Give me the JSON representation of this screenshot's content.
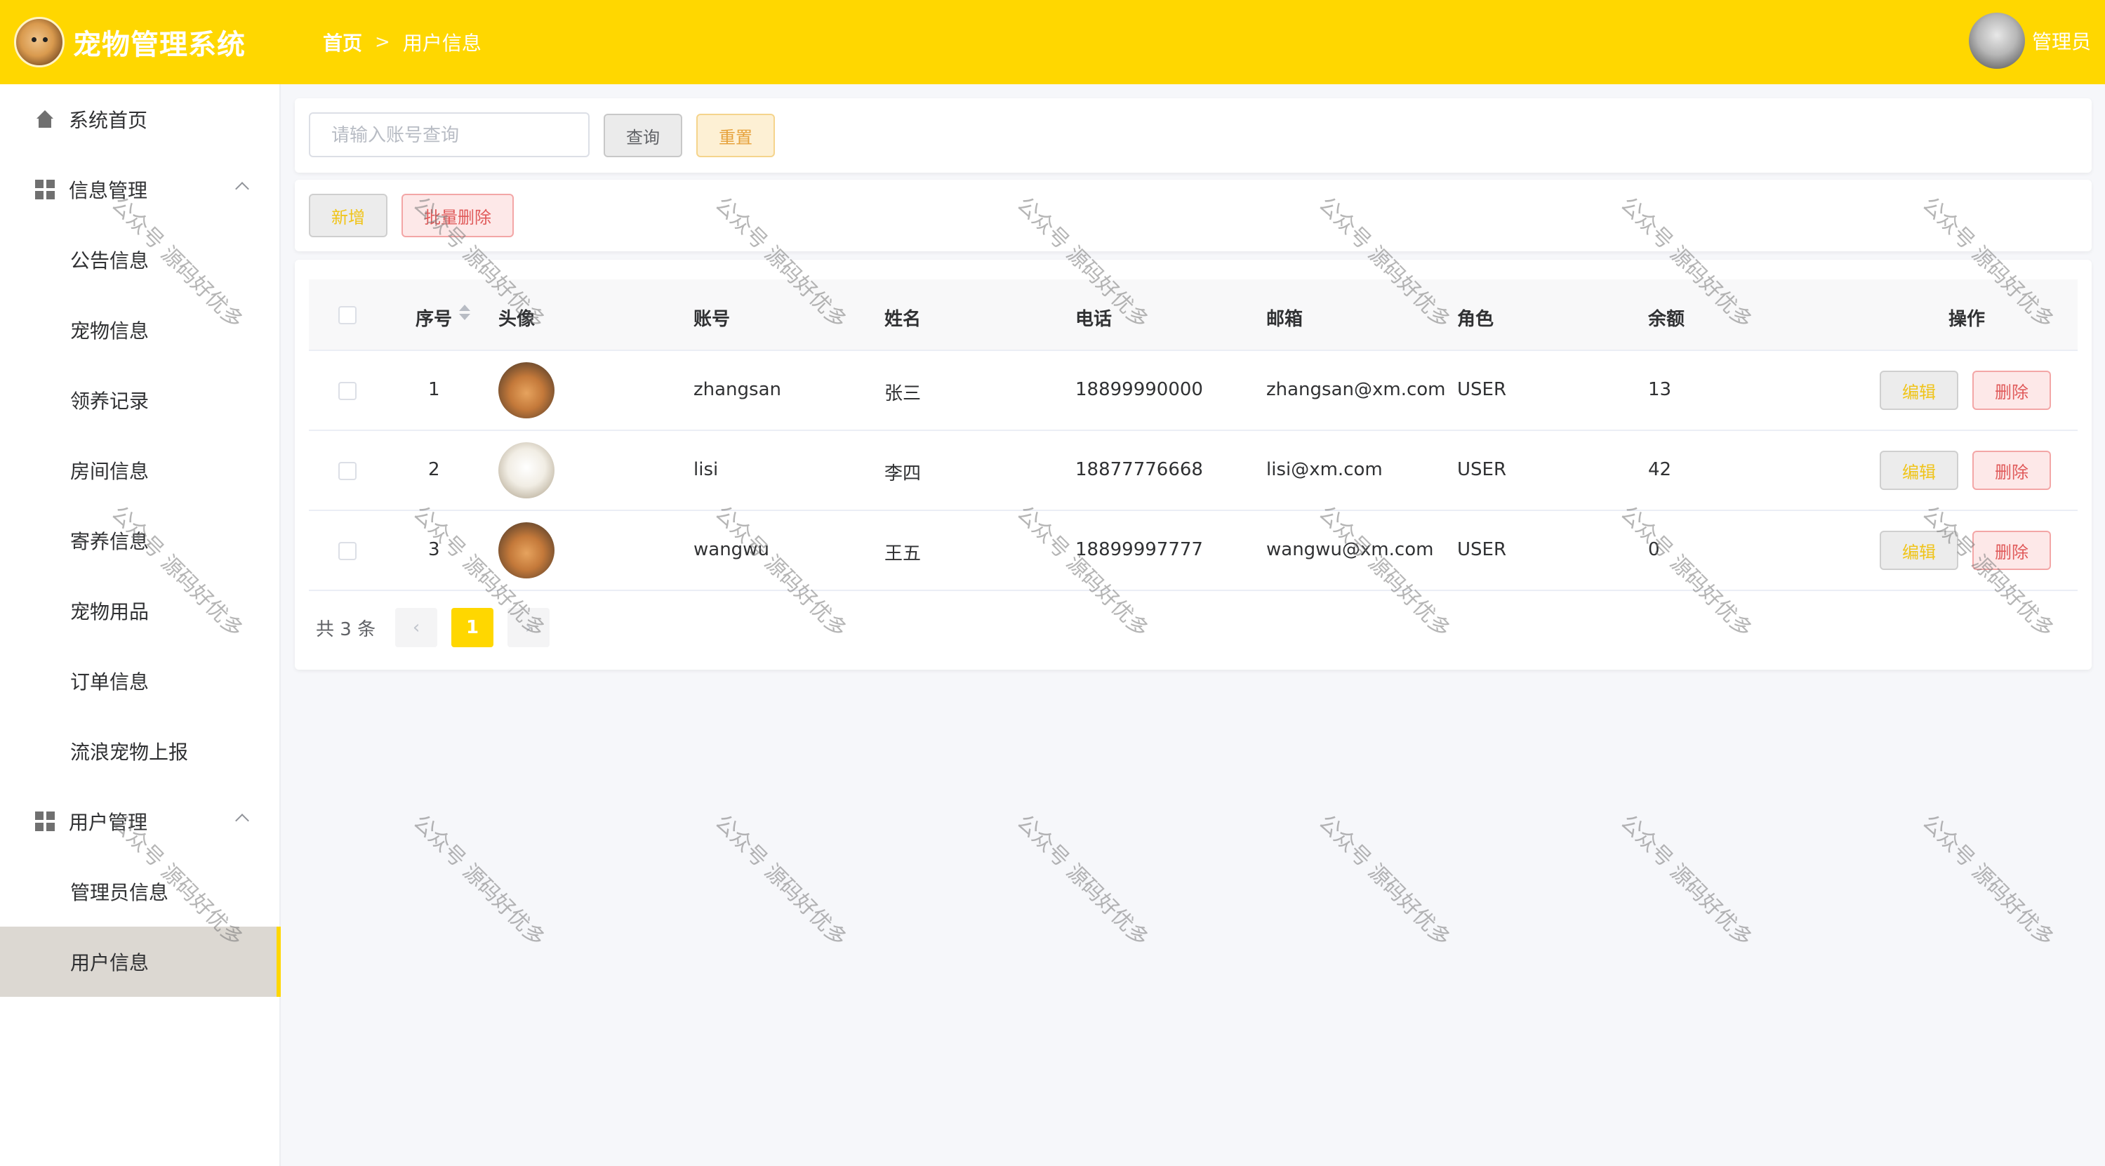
{
  "header": {
    "app_title": "宠物管理系统",
    "breadcrumb_home": "首页",
    "breadcrumb_separator": ">",
    "breadcrumb_current": "用户信息",
    "user_name": "管理员"
  },
  "sidebar": {
    "home": "系统首页",
    "groups": [
      {
        "title": "信息管理",
        "items": [
          "公告信息",
          "宠物信息",
          "领养记录",
          "房间信息",
          "寄养信息",
          "宠物用品",
          "订单信息",
          "流浪宠物上报"
        ]
      },
      {
        "title": "用户管理",
        "items": [
          "管理员信息",
          "用户信息"
        ]
      }
    ],
    "active_item": "用户信息"
  },
  "search": {
    "placeholder": "请输入账号查询",
    "query_label": "查询",
    "reset_label": "重置"
  },
  "toolbar": {
    "add_label": "新增",
    "batch_delete_label": "批量删除"
  },
  "table": {
    "columns": [
      "序号",
      "头像",
      "账号",
      "姓名",
      "电话",
      "邮箱",
      "角色",
      "余额",
      "操作"
    ],
    "rows": [
      {
        "index": "1",
        "avatar": "dog-avatar-orange",
        "account": "zhangsan",
        "name": "张三",
        "phone": "18899990000",
        "email": "zhangsan@xm.com",
        "role": "USER",
        "balance": "13"
      },
      {
        "index": "2",
        "avatar": "dog-avatar-white",
        "account": "lisi",
        "name": "李四",
        "phone": "18877776668",
        "email": "lisi@xm.com",
        "role": "USER",
        "balance": "42"
      },
      {
        "index": "3",
        "avatar": "dog-avatar-orange",
        "account": "wangwu",
        "name": "王五",
        "phone": "18899997777",
        "email": "wangwu@xm.com",
        "role": "USER",
        "balance": "0"
      }
    ],
    "edit_label": "编辑",
    "delete_label": "删除"
  },
  "pagination": {
    "total_text": "共 3 条",
    "current_page": "1",
    "prev_icon": "‹",
    "next_icon": "›"
  },
  "watermark": "公众号 源码好优多",
  "colors": {
    "header_bg": "#ffd700",
    "active_menu_bg": "#dcd8d2",
    "edit_text": "#f0c419",
    "delete_text": "#e05a5a"
  }
}
